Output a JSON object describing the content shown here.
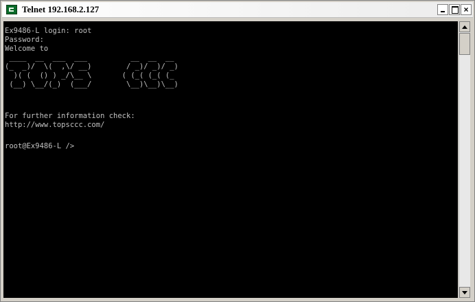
{
  "window": {
    "title": "Telnet 192.168.2.127",
    "controls": {
      "minimize": "-",
      "maximize": "",
      "close": "×"
    }
  },
  "terminal": {
    "lines": [
      "Ex9486-L login: root",
      "Password:",
      "Welcome to",
      " ____  __  ___  ___          __  __  __",
      "(_  _)/  \\(  ,\\/ __)        / _)/ _)/ _)",
      "  )( (  () ) _/\\__ \\       ( (_( (_( (_",
      " (__) \\__/(_)  (___/        \\__)\\__)\\__)",
      "",
      "For further information check:",
      "http://www.topsccc.com/",
      "",
      "root@Ex9486-L />"
    ]
  },
  "colors": {
    "terminal_bg": "#000000",
    "terminal_text": "#c0c0c0",
    "title_icon": "#0a6b2a"
  },
  "icons": {
    "app": "telnet-app-icon",
    "scroll_up": "arrow-up-icon",
    "scroll_down": "arrow-down-icon"
  }
}
